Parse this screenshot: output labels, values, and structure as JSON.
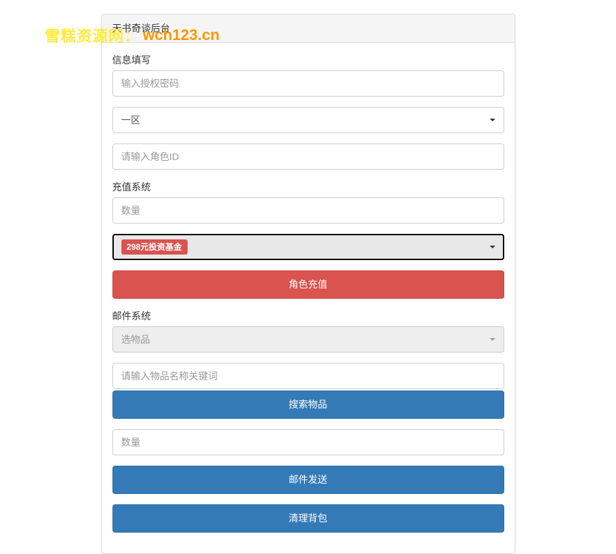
{
  "watermark": {
    "text": "雪糕资源网：",
    "url": "wch123.cn"
  },
  "panel": {
    "title": "天书奇谈后台"
  },
  "info_section": {
    "label": "信息填写",
    "password_placeholder": "输入授权密码",
    "zone_selected": "一区",
    "role_id_placeholder": "请输入角色ID"
  },
  "recharge_section": {
    "label": "充值系统",
    "quantity_placeholder": "数量",
    "product_selected": "298元投资基金",
    "recharge_button": "角色充值"
  },
  "mail_section": {
    "label": "邮件系统",
    "item_select_placeholder": "选物品",
    "item_search_placeholder": "请输入物品名称关键词",
    "search_button": "搜索物品",
    "quantity_placeholder": "数量",
    "send_button": "邮件发送",
    "clear_button": "清理背包"
  }
}
